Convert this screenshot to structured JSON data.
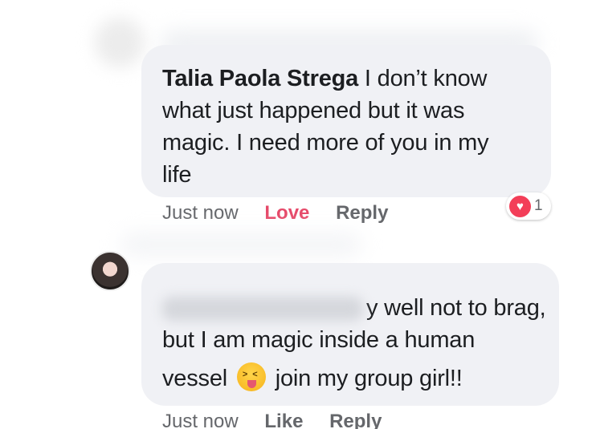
{
  "comment_1": {
    "author": "Talia Paola Strega",
    "text_lines": [
      " I don’t know",
      "what just happened but it was",
      "magic. I need more of you in my",
      "life"
    ],
    "time": "Just now",
    "love_label": "Love",
    "reply_label": "Reply",
    "reaction_count": "1",
    "reaction_icon": "heart-icon",
    "love_color": "#e64a6a"
  },
  "comment_2": {
    "author_visible_fragment": "y",
    "text_line_1": " well not to brag,",
    "text_line_2": "but I am magic inside a human",
    "text_line_3_before": "vessel ",
    "emoji": "squinting-face-with-tongue",
    "text_line_3_after": " join my group girl!!",
    "time": "Just now",
    "like_label": "Like",
    "reply_label": "Reply"
  },
  "colors": {
    "bubble": "#f0f1f5",
    "meta_text": "#65676b",
    "body_text": "#1c1e21",
    "heart": "#f33e58"
  }
}
